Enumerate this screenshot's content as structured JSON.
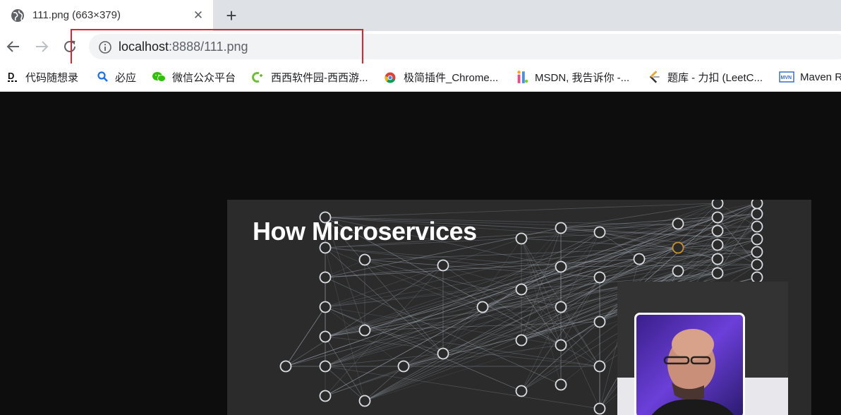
{
  "browser": {
    "tab": {
      "title": "111.png (663×379)",
      "close_glyph": "✕",
      "favicon": "globe-icon"
    },
    "new_tab_glyph": "+",
    "address": {
      "host": "localhost",
      "rest": ":8888/111.png"
    },
    "bookmarks": [
      {
        "label": "代码随想录",
        "icon": "daima-icon"
      },
      {
        "label": "必应",
        "icon": "bing-search-icon"
      },
      {
        "label": "微信公众平台",
        "icon": "wechat-icon"
      },
      {
        "label": "西西软件园-西西游...",
        "icon": "cr173-icon"
      },
      {
        "label": "极简插件_Chrome...",
        "icon": "chrome-icon"
      },
      {
        "label": "MSDN, 我告诉你 -...",
        "icon": "msdn-icon"
      },
      {
        "label": "题库 - 力扣 (LeetC...",
        "icon": "leetcode-icon"
      },
      {
        "label": "Maven R",
        "icon": "maven-icon"
      }
    ]
  },
  "slide": {
    "title": "How Microservices"
  },
  "colors": {
    "highlight_border": "#e3232c",
    "viewer_bg": "#0d0d0d",
    "slide_bg": "#2b2b2b"
  }
}
